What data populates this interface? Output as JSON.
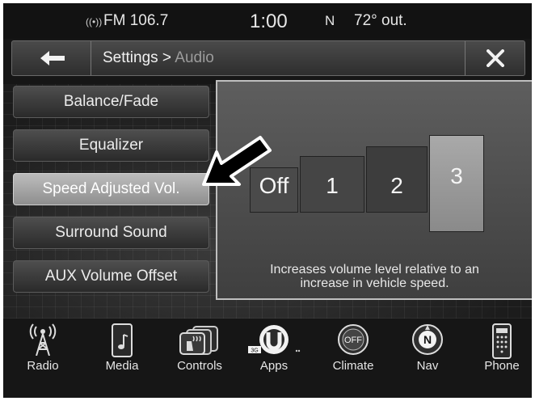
{
  "status": {
    "station": "FM 106.7",
    "time": "1:00",
    "compass": "N",
    "temperature": "72° out."
  },
  "header": {
    "crumb_main": "Settings > ",
    "crumb_sub": "Audio"
  },
  "menu": [
    {
      "label": "Balance/Fade",
      "active": false
    },
    {
      "label": "Equalizer",
      "active": false
    },
    {
      "label": "Speed Adjusted Vol.",
      "active": true
    },
    {
      "label": "Surround Sound",
      "active": false
    },
    {
      "label": "AUX Volume Offset",
      "active": false
    }
  ],
  "panel": {
    "options": [
      "Off",
      "1",
      "2",
      "3"
    ],
    "selected": "3",
    "description_line1": "Increases volume level relative to an",
    "description_line2": "increase in vehicle speed."
  },
  "bottom_nav": [
    {
      "label": "Radio",
      "icon": "radio-tower-icon"
    },
    {
      "label": "Media",
      "icon": "media-phone-icon"
    },
    {
      "label": "Controls",
      "icon": "heated-seat-icon"
    },
    {
      "label": "Apps",
      "icon": "uconnect-icon",
      "badge": "3G"
    },
    {
      "label": "Climate",
      "icon": "climate-off-icon",
      "icon_text": "OFF"
    },
    {
      "label": "Nav",
      "icon": "compass-icon",
      "icon_text": "N"
    },
    {
      "label": "Phone",
      "icon": "phone-keypad-icon"
    }
  ]
}
